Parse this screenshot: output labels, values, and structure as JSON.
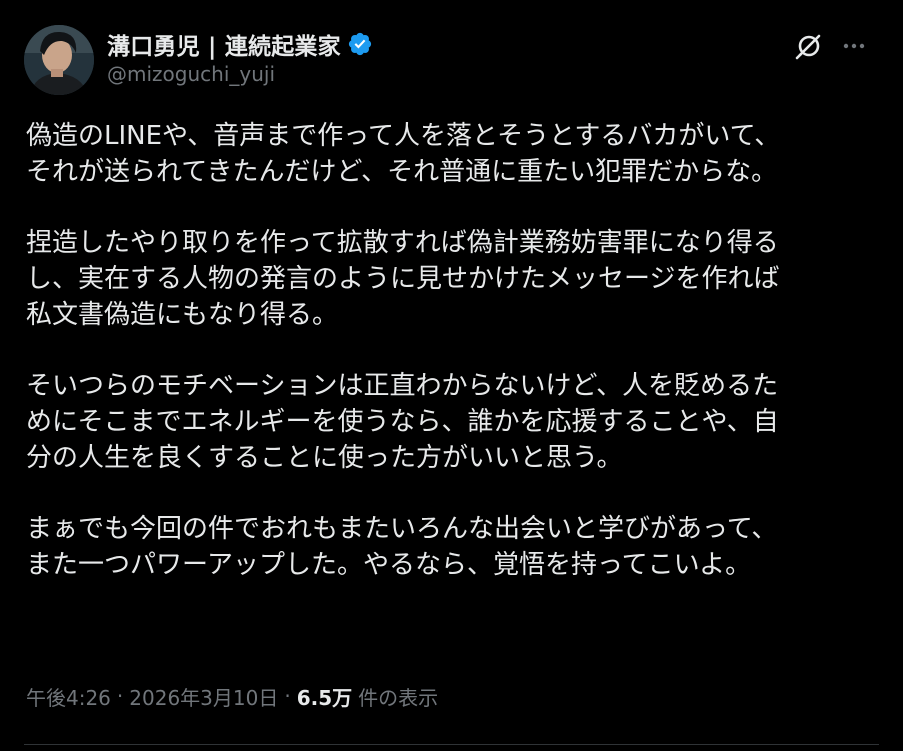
{
  "author": {
    "display_name": "溝口勇児 | 連続起業家",
    "handle": "@mizoguchi_yuji",
    "verified": true
  },
  "actions": {
    "grok_icon": "grok-icon",
    "more_icon": "more-icon"
  },
  "post": {
    "paragraphs": [
      [
        "偽造のLINEや、音声まで作って人を落とそうとするバカがいて、",
        "それが送られてきたんだけど、それ普通に重たい犯罪だからな。"
      ],
      [
        "捏造したやり取りを作って拡散すれば偽計業務妨害罪になり得る",
        "し、実在する人物の発言のように見せかけたメッセージを作れば",
        "私文書偽造にもなり得る。"
      ],
      [
        "そいつらのモチベーションは正直わからないけど、人を貶めるた",
        "めにそこまでエネルギーを使うなら、誰かを応援することや、自",
        "分の人生を良くすることに使った方がいいと思う。"
      ],
      [
        "まぁでも今回の件でおれもまたいろんな出会いと学びがあって、",
        "また一つパワーアップした。やるなら、覚悟を持ってこいよ。"
      ]
    ]
  },
  "meta": {
    "time": "午後4:26",
    "separator": "·",
    "date": "2026年3月10日",
    "views_count": "6.5万",
    "views_label": "件の表示"
  },
  "colors": {
    "background": "#000000",
    "text": "#e7e9ea",
    "secondary": "#71767b",
    "verified": "#1d9bf0"
  }
}
